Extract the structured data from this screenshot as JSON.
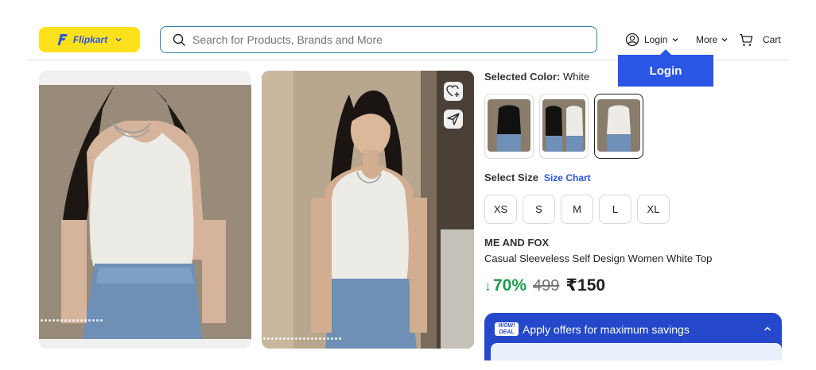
{
  "header": {
    "logo_text": "Flipkart",
    "search_placeholder": "Search for Products, Brands and More",
    "login_label": "Login",
    "more_label": "More",
    "cart_label": "Cart",
    "login_popup_label": "Login"
  },
  "product": {
    "selected_color_label": "Selected Color:",
    "selected_color_value": "White",
    "select_size_label": "Select Size",
    "size_chart_label": "Size Chart",
    "sizes": [
      "XS",
      "S",
      "M",
      "L",
      "XL"
    ],
    "brand": "ME AND FOX",
    "title": "Casual Sleeveless Self Design Women White Top",
    "discount": "70%",
    "mrp": "499",
    "price": "₹150",
    "offers_badge": "WOW! DEAL",
    "offers_text": "Apply offers for maximum savings"
  },
  "colors": {
    "accent": "#2a55e5",
    "logo_bg": "#ffe11b",
    "discount": "#1c9d4b",
    "offers_bg": "#2448c9"
  }
}
